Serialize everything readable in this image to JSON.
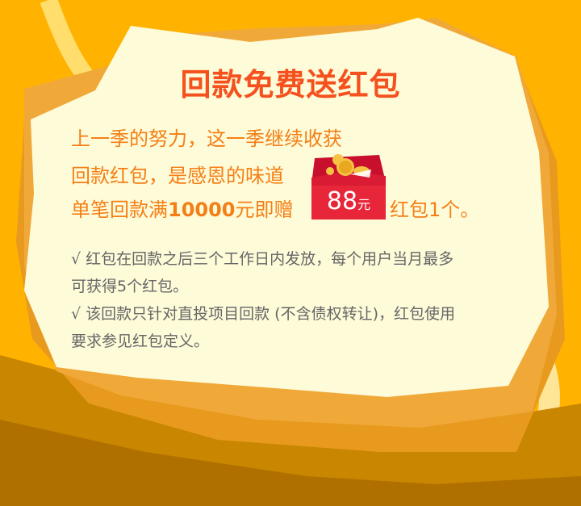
{
  "title": "回款免费送红包",
  "lines": {
    "line1": "上一季的努力，这一季继续收获",
    "line2": "回款红包，是感恩的味道",
    "line3_prefix": "单笔回款满",
    "line3_amount": "10000",
    "line3_suffix": "元即赠",
    "line3_tail": "红包1个。"
  },
  "red_packet": {
    "amount": "88",
    "unit": "元"
  },
  "notes": [
    "√ 红包在回款之后三个工作日内发放，每个用户当月最多",
    "可获得5个红包。",
    "√ 该回款只针对直投项目回款 (不含债权转让)，红包使用",
    "要求参见红包定义。"
  ],
  "colors": {
    "background": "#FFB300",
    "card": "#FEFBD9",
    "card_shadow": "#E6A126",
    "title": "#F4511E",
    "highlight": "#F47F16",
    "note": "#666666",
    "red_packet": "#E8263A"
  }
}
